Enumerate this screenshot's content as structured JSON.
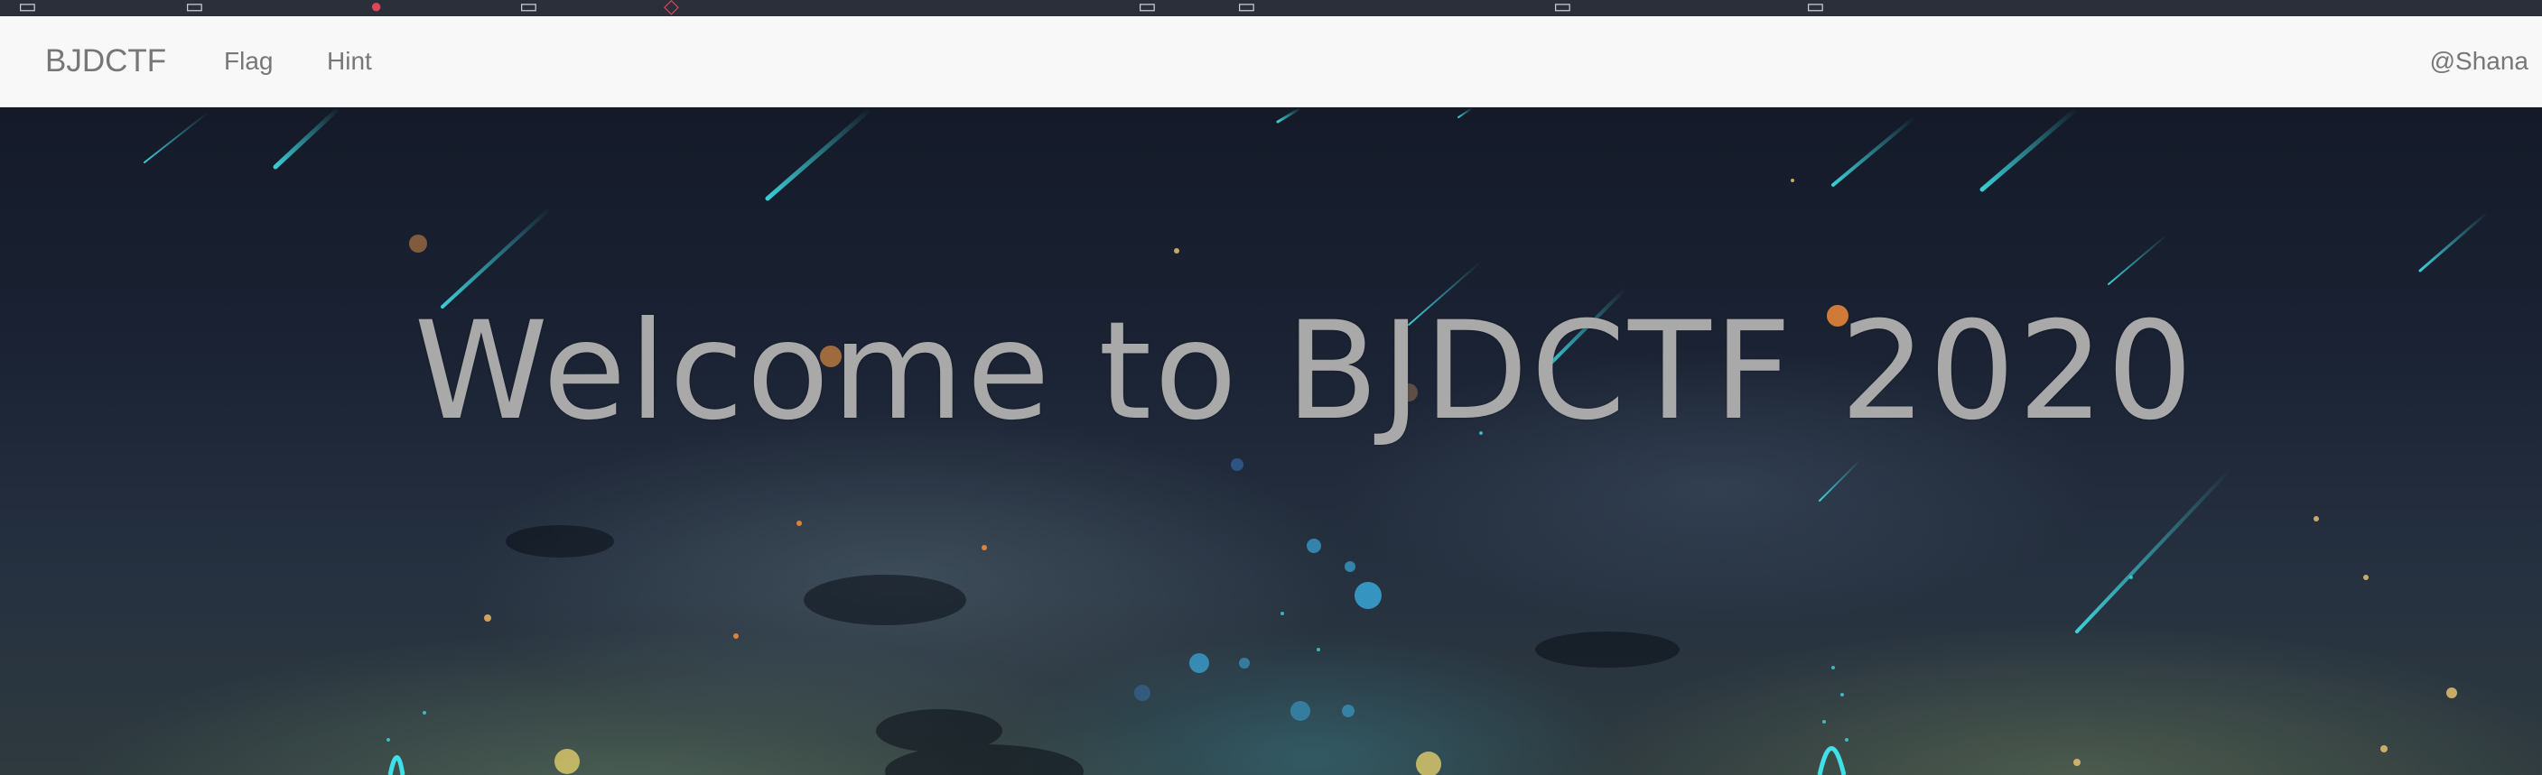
{
  "navbar": {
    "brand": "BJDCTF",
    "links": [
      {
        "label": "Flag"
      },
      {
        "label": "Hint"
      }
    ],
    "user": "@Shana"
  },
  "hero": {
    "heading": "Welcome to BJDCTF 2020"
  },
  "colors": {
    "navbar_bg": "#f8f8f8",
    "nav_text": "#777777",
    "heading_text": "#a9a9a9",
    "meteor": "#3fe0e8"
  }
}
